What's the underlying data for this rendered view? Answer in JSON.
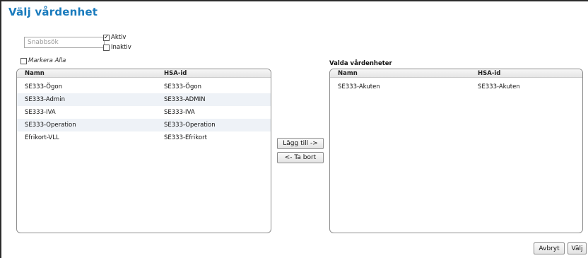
{
  "dialog": {
    "title": "Välj vårdenhet"
  },
  "filter": {
    "search_placeholder": "Snabbsök",
    "aktiv_label": "Aktiv",
    "aktiv_checked": true,
    "inaktiv_label": "Inaktiv",
    "inaktiv_checked": false,
    "markera_alla_label": "Markera Alla",
    "markera_alla_checked": false
  },
  "available": {
    "columns": [
      "Namn",
      "HSA-id"
    ],
    "rows": [
      {
        "namn": "SE333-Ögon",
        "hsa": "SE333-Ögon"
      },
      {
        "namn": "SE333-Admin",
        "hsa": "SE333-ADMIN"
      },
      {
        "namn": "SE333-IVA",
        "hsa": "SE333-IVA"
      },
      {
        "namn": "SE333-Operation",
        "hsa": "SE333-Operation"
      },
      {
        "namn": "Efrikort-VLL",
        "hsa": "SE333-Efrikort"
      }
    ]
  },
  "transfer": {
    "add_label": "Lägg till ->",
    "remove_label": "<- Ta bort"
  },
  "selected": {
    "heading": "Valda vårdenheter",
    "columns": [
      "Namn",
      "HSA-id"
    ],
    "rows": [
      {
        "namn": "SE333-Akuten",
        "hsa": "SE333-Akuten"
      }
    ]
  },
  "footer": {
    "cancel_label": "Avbryt",
    "choose_label": "Välj"
  }
}
